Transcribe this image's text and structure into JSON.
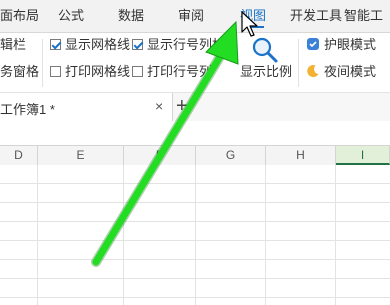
{
  "ribbon": {
    "tabs": [
      {
        "label": "面布局"
      },
      {
        "label": "公式"
      },
      {
        "label": "数据"
      },
      {
        "label": "审阅"
      },
      {
        "label": "视图",
        "active": true
      },
      {
        "label": "开发工具"
      },
      {
        "label": "智能工"
      }
    ],
    "accent_color": "#1a73c8"
  },
  "toolbar": {
    "partial_top": "辑栏",
    "partial_bottom": "务窗格",
    "show_gridlines": {
      "label": "显示网格线",
      "checked": true
    },
    "show_row_col_headers": {
      "label": "显示行号列标",
      "checked": true
    },
    "print_gridlines": {
      "label": "打印网格线",
      "checked": false
    },
    "print_row_col_headers": {
      "label": "打印行号列",
      "checked": false
    },
    "zoom_label": "显示比例",
    "eye_protection": {
      "label": "护眼模式",
      "icon": "eye-protection-icon"
    },
    "night_mode": {
      "label": "夜间模式",
      "icon": "moon-icon"
    }
  },
  "doc_tab": {
    "title": "工作簿1 *",
    "close": "×",
    "add": "+"
  },
  "columns": [
    "D",
    "E",
    "F",
    "G",
    "H",
    "I"
  ],
  "selected_column": "I",
  "annotation": {
    "arrow_color": "#22dd22"
  }
}
